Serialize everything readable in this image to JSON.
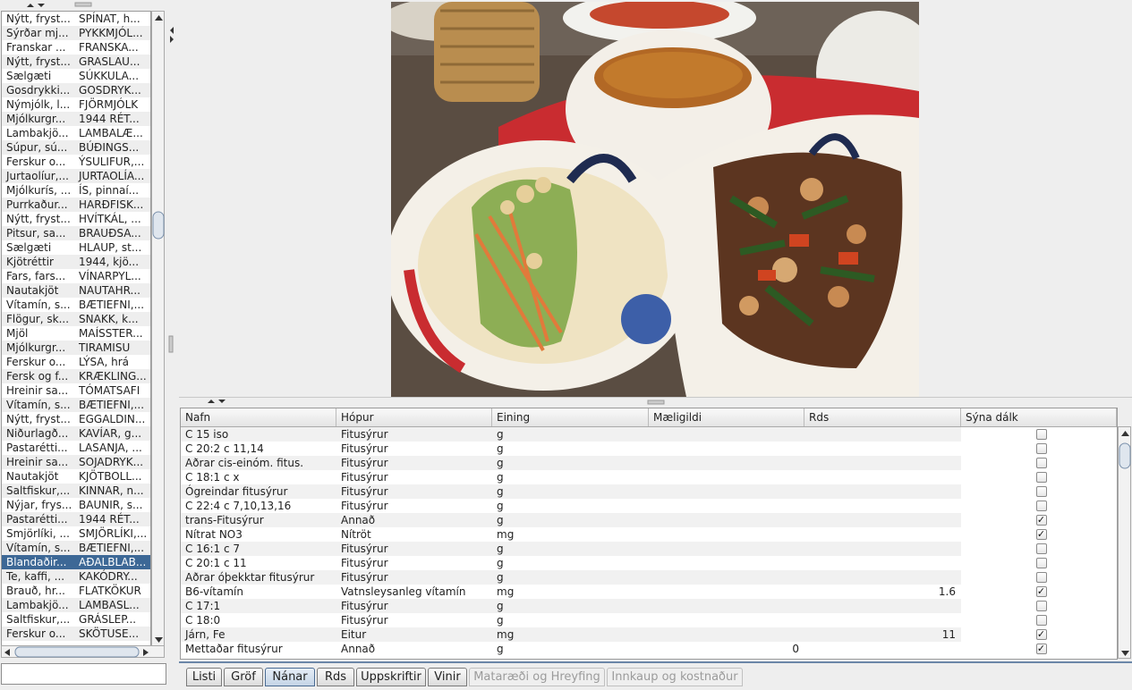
{
  "food_list": {
    "rows": [
      [
        "Nýtt, fryst...",
        "SPÍNAT, h..."
      ],
      [
        "Sýrðar mj...",
        "PYKKMJÓL..."
      ],
      [
        "Franskar ...",
        "FRANSKA..."
      ],
      [
        "Nýtt, fryst...",
        "GRASLAU..."
      ],
      [
        "Sælgæti",
        "SÚKKULA..."
      ],
      [
        "Gosdrykki...",
        "GOSDRYK..."
      ],
      [
        "Nýmjólk, l...",
        "FJÖRMJÓLK"
      ],
      [
        "Mjólkurgr...",
        "1944 RÉT..."
      ],
      [
        "Lambakjö...",
        "LAMBALÆ..."
      ],
      [
        "Súpur, sú...",
        "BÚÐINGS..."
      ],
      [
        "Ferskur o...",
        "ÝSULIFUR,..."
      ],
      [
        "Jurtaolíur,...",
        "JURTAOLÍA..."
      ],
      [
        "Mjólkurís, ...",
        "ÍS, pinnaí..."
      ],
      [
        "Purrkaður...",
        "HARÐFISK..."
      ],
      [
        "Nýtt, fryst...",
        "HVÍTKÁL, ..."
      ],
      [
        "Pitsur, sa...",
        "BRAUÐSA..."
      ],
      [
        "Sælgæti",
        "HLAUP, st..."
      ],
      [
        "Kjötréttir",
        "1944, kjö..."
      ],
      [
        "Fars, fars...",
        "VÍNARPYL..."
      ],
      [
        "Nautakjöt",
        "NAUTAHR..."
      ],
      [
        "Vítamín, s...",
        "BÆTIEFNI,..."
      ],
      [
        "Flögur, sk...",
        "SNAKK, k..."
      ],
      [
        "Mjöl",
        "MAÍSSTER..."
      ],
      [
        "Mjólkurgr...",
        "TIRAMISU"
      ],
      [
        "Ferskur o...",
        "LÝSA, hrá"
      ],
      [
        "Fersk og f...",
        "KRÆKLING..."
      ],
      [
        "Hreinir sa...",
        "TÓMATSAFI"
      ],
      [
        "Vítamín, s...",
        "BÆTIEFNI,..."
      ],
      [
        "Nýtt, fryst...",
        "EGGALDIN..."
      ],
      [
        "Niðurlagð...",
        "KAVÍAR, g..."
      ],
      [
        "Pastarétti...",
        "LASANJA, ..."
      ],
      [
        "Hreinir sa...",
        "SOJADRYK..."
      ],
      [
        "Nautakjöt",
        "KJÖTBOLL..."
      ],
      [
        "Saltfiskur,...",
        "KINNAR, n..."
      ],
      [
        "Nýjar, frys...",
        "BAUNIR, s..."
      ],
      [
        "Pastarétti...",
        "1944 RÉT..."
      ],
      [
        "Smjörlíki, ...",
        "SMJÖRLÍKI,..."
      ],
      [
        "Vítamín, s...",
        "BÆTIEFNI,..."
      ],
      [
        "Blandaðir...",
        "AÐALBLAB..."
      ],
      [
        "Te, kaffi, ...",
        "KAKÓDRY..."
      ],
      [
        "Brauð, hr...",
        "FLATKÖKUR"
      ],
      [
        "Lambakjö...",
        "LAMBASL..."
      ],
      [
        "Saltfiskur,...",
        "GRÁSLEP..."
      ],
      [
        "Ferskur o...",
        "SKÖTUSE..."
      ]
    ],
    "selected_index": 38,
    "search_value": ""
  },
  "detail_table": {
    "columns": [
      "Nafn",
      "Hópur",
      "Eining",
      "Mæligildi",
      "Rds",
      "Sýna dálk"
    ],
    "rows": [
      {
        "name": "C 15 iso",
        "group": "Fitusýrur",
        "unit": "g",
        "value": "",
        "rds": "",
        "show": false
      },
      {
        "name": "C 20:2 c 11,14",
        "group": "Fitusýrur",
        "unit": "g",
        "value": "",
        "rds": "",
        "show": false
      },
      {
        "name": "Aðrar cis-einóm. fitus.",
        "group": "Fitusýrur",
        "unit": "g",
        "value": "",
        "rds": "",
        "show": false
      },
      {
        "name": "C 18:1 c x",
        "group": "Fitusýrur",
        "unit": "g",
        "value": "",
        "rds": "",
        "show": false
      },
      {
        "name": "Ógreindar fitusýrur",
        "group": "Fitusýrur",
        "unit": "g",
        "value": "",
        "rds": "",
        "show": false
      },
      {
        "name": "C 22:4 c 7,10,13,16",
        "group": "Fitusýrur",
        "unit": "g",
        "value": "",
        "rds": "",
        "show": false
      },
      {
        "name": "trans-Fitusýrur",
        "group": "Annað",
        "unit": "g",
        "value": "",
        "rds": "",
        "show": true
      },
      {
        "name": "Nítrat NO3",
        "group": "Nítröt",
        "unit": "mg",
        "value": "",
        "rds": "",
        "show": true
      },
      {
        "name": "C 16:1 c 7",
        "group": "Fitusýrur",
        "unit": "g",
        "value": "",
        "rds": "",
        "show": false
      },
      {
        "name": "C 20:1 c 11",
        "group": "Fitusýrur",
        "unit": "g",
        "value": "",
        "rds": "",
        "show": false
      },
      {
        "name": "Aðrar óþekktar fitusýrur",
        "group": "Fitusýrur",
        "unit": "g",
        "value": "",
        "rds": "",
        "show": false
      },
      {
        "name": "B6-vítamín",
        "group": "Vatnsleysanleg vítamín",
        "unit": "mg",
        "value": "",
        "rds": "1.6",
        "show": true
      },
      {
        "name": "C 17:1",
        "group": "Fitusýrur",
        "unit": "g",
        "value": "",
        "rds": "",
        "show": false
      },
      {
        "name": "C 18:0",
        "group": "Fitusýrur",
        "unit": "g",
        "value": "",
        "rds": "",
        "show": false
      },
      {
        "name": "Járn, Fe",
        "group": "Eitur",
        "unit": "mg",
        "value": "",
        "rds": "11",
        "show": true
      },
      {
        "name": "Mettaðar fitusýrur",
        "group": "Annað",
        "unit": "g",
        "value": "0",
        "rds": "",
        "show": true
      }
    ]
  },
  "tabs": [
    {
      "label": "Listi",
      "state": "normal"
    },
    {
      "label": "Gröf",
      "state": "normal"
    },
    {
      "label": "Nánar",
      "state": "active"
    },
    {
      "label": "Rds",
      "state": "normal"
    },
    {
      "label": "Uppskriftir",
      "state": "normal"
    },
    {
      "label": "Vinir",
      "state": "normal"
    },
    {
      "label": "Mataræði og Hreyfing",
      "state": "disabled"
    },
    {
      "label": "Innkaup og kostnaður",
      "state": "disabled"
    }
  ],
  "colors": {
    "selection": "#3d6896",
    "active_tab": "#c4d4e6",
    "tab_border": "#6b87a8"
  }
}
